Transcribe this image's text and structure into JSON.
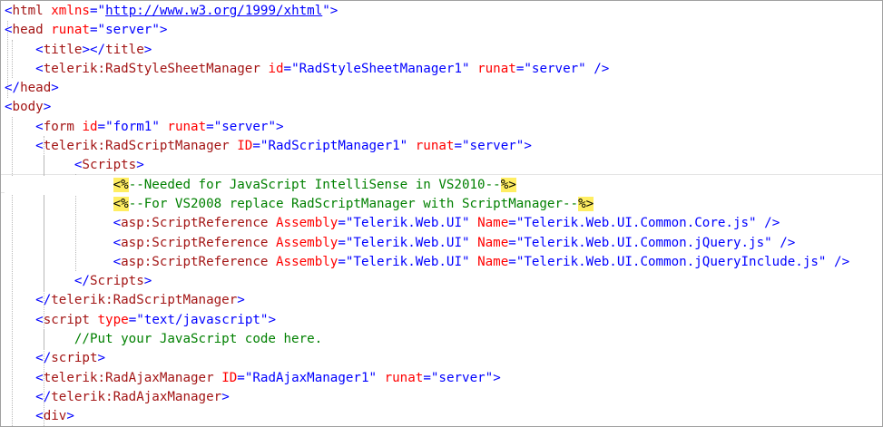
{
  "editor": {
    "lines": [
      {
        "indent": "",
        "tokens": [
          [
            "br",
            "<"
          ],
          [
            "tag",
            "html"
          ],
          [
            "txt",
            " "
          ],
          [
            "attr",
            "xmlns"
          ],
          [
            "br",
            "="
          ],
          [
            "val",
            "\""
          ],
          [
            "link",
            "http://www.w3.org/1999/xhtml"
          ],
          [
            "val",
            "\""
          ],
          [
            "br",
            ">"
          ]
        ]
      },
      {
        "indent": "",
        "tokens": [
          [
            "br",
            "<"
          ],
          [
            "tag",
            "head"
          ],
          [
            "txt",
            " "
          ],
          [
            "attr",
            "runat"
          ],
          [
            "br",
            "="
          ],
          [
            "val",
            "\"server\""
          ],
          [
            "br",
            ">"
          ]
        ]
      },
      {
        "indent": "    ",
        "tokens": [
          [
            "br",
            "<"
          ],
          [
            "tag",
            "title"
          ],
          [
            "br",
            "></"
          ],
          [
            "tag",
            "title"
          ],
          [
            "br",
            ">"
          ]
        ]
      },
      {
        "indent": "    ",
        "tokens": [
          [
            "br",
            "<"
          ],
          [
            "tag",
            "telerik:RadStyleSheetManager"
          ],
          [
            "txt",
            " "
          ],
          [
            "attr",
            "id"
          ],
          [
            "br",
            "="
          ],
          [
            "val",
            "\"RadStyleSheetManager1\""
          ],
          [
            "txt",
            " "
          ],
          [
            "attr",
            "runat"
          ],
          [
            "br",
            "="
          ],
          [
            "val",
            "\"server\""
          ],
          [
            "txt",
            " "
          ],
          [
            "br",
            "/>"
          ]
        ]
      },
      {
        "indent": "",
        "tokens": [
          [
            "br",
            "</"
          ],
          [
            "tag",
            "head"
          ],
          [
            "br",
            ">"
          ]
        ]
      },
      {
        "indent": "",
        "tokens": [
          [
            "br",
            "<"
          ],
          [
            "tag",
            "body"
          ],
          [
            "br",
            ">"
          ]
        ]
      },
      {
        "indent": "    ",
        "tokens": [
          [
            "br",
            "<"
          ],
          [
            "tag",
            "form"
          ],
          [
            "txt",
            " "
          ],
          [
            "attr",
            "id"
          ],
          [
            "br",
            "="
          ],
          [
            "val",
            "\"form1\""
          ],
          [
            "txt",
            " "
          ],
          [
            "attr",
            "runat"
          ],
          [
            "br",
            "="
          ],
          [
            "val",
            "\"server\""
          ],
          [
            "br",
            ">"
          ]
        ]
      },
      {
        "indent": "    ",
        "tokens": [
          [
            "br",
            "<"
          ],
          [
            "tag",
            "telerik:RadScriptManager"
          ],
          [
            "txt",
            " "
          ],
          [
            "attr",
            "ID"
          ],
          [
            "br",
            "="
          ],
          [
            "val",
            "\"RadScriptManager1\""
          ],
          [
            "txt",
            " "
          ],
          [
            "attr",
            "runat"
          ],
          [
            "br",
            "="
          ],
          [
            "val",
            "\"server\""
          ],
          [
            "br",
            ">"
          ]
        ]
      },
      {
        "indent": "         ",
        "tokens": [
          [
            "br",
            "<"
          ],
          [
            "tag",
            "Scripts"
          ],
          [
            "br",
            ">"
          ]
        ]
      },
      {
        "indent": "              ",
        "tokens": [
          [
            "hl",
            "<%"
          ],
          [
            "cm",
            "--Needed for JavaScript IntelliSense in VS2010--"
          ],
          [
            "hl",
            "%>"
          ]
        ]
      },
      {
        "indent": "              ",
        "tokens": [
          [
            "hl",
            "<%"
          ],
          [
            "cm",
            "--For VS2008 replace RadScriptManager with ScriptManager--"
          ],
          [
            "hl",
            "%>"
          ]
        ]
      },
      {
        "indent": "              ",
        "tokens": [
          [
            "br",
            "<"
          ],
          [
            "tag",
            "asp:ScriptReference"
          ],
          [
            "txt",
            " "
          ],
          [
            "attr",
            "Assembly"
          ],
          [
            "br",
            "="
          ],
          [
            "val",
            "\"Telerik.Web.UI\""
          ],
          [
            "txt",
            " "
          ],
          [
            "attr",
            "Name"
          ],
          [
            "br",
            "="
          ],
          [
            "val",
            "\"Telerik.Web.UI.Common.Core.js\""
          ],
          [
            "txt",
            " "
          ],
          [
            "br",
            "/>"
          ]
        ]
      },
      {
        "indent": "              ",
        "tokens": [
          [
            "br",
            "<"
          ],
          [
            "tag",
            "asp:ScriptReference"
          ],
          [
            "txt",
            " "
          ],
          [
            "attr",
            "Assembly"
          ],
          [
            "br",
            "="
          ],
          [
            "val",
            "\"Telerik.Web.UI\""
          ],
          [
            "txt",
            " "
          ],
          [
            "attr",
            "Name"
          ],
          [
            "br",
            "="
          ],
          [
            "val",
            "\"Telerik.Web.UI.Common.jQuery.js\""
          ],
          [
            "txt",
            " "
          ],
          [
            "br",
            "/>"
          ]
        ]
      },
      {
        "indent": "              ",
        "tokens": [
          [
            "br",
            "<"
          ],
          [
            "tag",
            "asp:ScriptReference"
          ],
          [
            "txt",
            " "
          ],
          [
            "attr",
            "Assembly"
          ],
          [
            "br",
            "="
          ],
          [
            "val",
            "\"Telerik.Web.UI\""
          ],
          [
            "txt",
            " "
          ],
          [
            "attr",
            "Name"
          ],
          [
            "br",
            "="
          ],
          [
            "val",
            "\"Telerik.Web.UI.Common.jQueryInclude.js\""
          ],
          [
            "txt",
            " "
          ],
          [
            "br",
            "/>"
          ]
        ]
      },
      {
        "indent": "         ",
        "tokens": [
          [
            "br",
            "</"
          ],
          [
            "tag",
            "Scripts"
          ],
          [
            "br",
            ">"
          ]
        ]
      },
      {
        "indent": "    ",
        "tokens": [
          [
            "br",
            "</"
          ],
          [
            "tag",
            "telerik:RadScriptManager"
          ],
          [
            "br",
            ">"
          ]
        ]
      },
      {
        "indent": "    ",
        "tokens": [
          [
            "br",
            "<"
          ],
          [
            "tag",
            "script"
          ],
          [
            "txt",
            " "
          ],
          [
            "attr",
            "type"
          ],
          [
            "br",
            "="
          ],
          [
            "val",
            "\"text/javascript\""
          ],
          [
            "br",
            ">"
          ]
        ]
      },
      {
        "indent": "         ",
        "tokens": [
          [
            "cm",
            "//Put your JavaScript code here."
          ]
        ]
      },
      {
        "indent": "    ",
        "tokens": [
          [
            "br",
            "</"
          ],
          [
            "tag",
            "script"
          ],
          [
            "br",
            ">"
          ]
        ]
      },
      {
        "indent": "    ",
        "tokens": [
          [
            "br",
            "<"
          ],
          [
            "tag",
            "telerik:RadAjaxManager"
          ],
          [
            "txt",
            " "
          ],
          [
            "attr",
            "ID"
          ],
          [
            "br",
            "="
          ],
          [
            "val",
            "\"RadAjaxManager1\""
          ],
          [
            "txt",
            " "
          ],
          [
            "attr",
            "runat"
          ],
          [
            "br",
            "="
          ],
          [
            "val",
            "\"server\""
          ],
          [
            "br",
            ">"
          ]
        ]
      },
      {
        "indent": "    ",
        "tokens": [
          [
            "br",
            "</"
          ],
          [
            "tag",
            "telerik:RadAjaxManager"
          ],
          [
            "br",
            ">"
          ]
        ]
      },
      {
        "indent": "    ",
        "tokens": [
          [
            "br",
            "<"
          ],
          [
            "tag",
            "div"
          ],
          [
            "br",
            ">"
          ]
        ]
      }
    ]
  },
  "colors": {
    "tag": "#a31515",
    "attribute": "#ff0000",
    "value": "#0000ff",
    "comment": "#008000",
    "server_block_highlight": "#ffee62"
  }
}
